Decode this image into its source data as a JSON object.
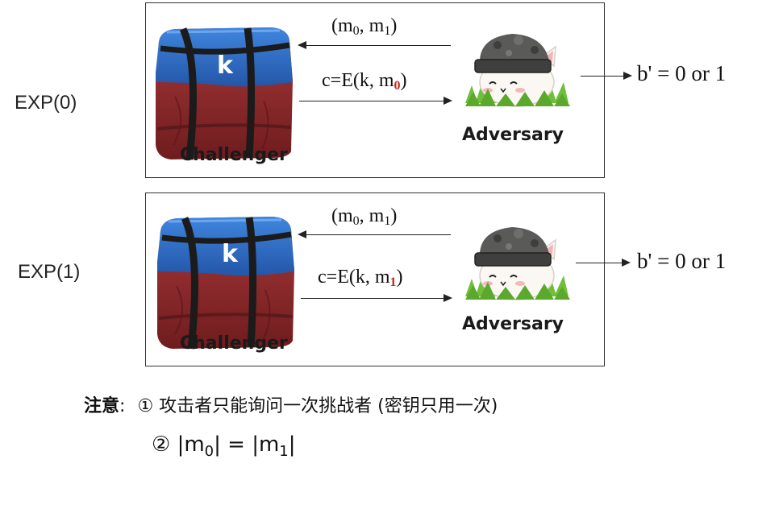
{
  "experiments": [
    {
      "label": "EXP(0)",
      "query_text": "(m",
      "query_sub0": "0",
      "query_mid": ", m",
      "query_sub1": "1",
      "query_close": ")",
      "cipher_prefix": "c=E(k, m",
      "cipher_bit": "0",
      "cipher_close": ")",
      "box_key": "k",
      "challenger_label": "Challenger",
      "adversary_label": "Adversary",
      "result": "b' = 0 or 1"
    },
    {
      "label": "EXP(1)",
      "query_text": "(m",
      "query_sub0": "0",
      "query_mid": ", m",
      "query_sub1": "1",
      "query_close": ")",
      "cipher_prefix": "c=E(k, m",
      "cipher_bit": "1",
      "cipher_close": ")",
      "box_key": "k",
      "challenger_label": "Challenger",
      "adversary_label": "Adversary",
      "result": "b' = 0 or 1"
    }
  ],
  "notes": {
    "heading": "注意",
    "colon": ":",
    "item1": "① 攻击者只能询问一次挑战者 (密钥只用一次)",
    "item2_prefix": "② |m",
    "item2_sub0": "0",
    "item2_mid": "| = |m",
    "item2_sub1": "1",
    "item2_close": "|"
  },
  "colors": {
    "box_blue": "#2f6fc4",
    "box_red": "#9e2a2b",
    "strap": "#1b1b1b",
    "highlight_red": "#c0261c",
    "grass": "#6fbf3a",
    "helmet": "#5a5a58"
  }
}
